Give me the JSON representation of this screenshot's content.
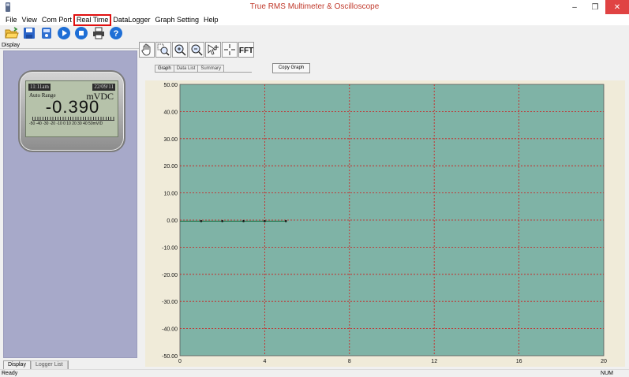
{
  "window": {
    "title": "True RMS Multimeter & Oscilloscope",
    "app_icon": "app-icon",
    "controls": {
      "minimize": "–",
      "maximize": "❐",
      "close": "✕"
    }
  },
  "menu": [
    {
      "label": "File"
    },
    {
      "label": "View"
    },
    {
      "label": "Com Port"
    },
    {
      "label": "Real Time",
      "highlighted": true
    },
    {
      "label": "DataLogger"
    },
    {
      "label": "Graph Setting"
    },
    {
      "label": "Help"
    }
  ],
  "toolbar": {
    "icons": [
      "open-folder-icon",
      "save-icon",
      "meter-icon",
      "play-icon",
      "stop-icon",
      "print-icon",
      "help-icon"
    ]
  },
  "left_panel": {
    "header": "Display",
    "meter": {
      "time": "11:11am",
      "date": "22/09/11",
      "range_mode": "Auto Range",
      "unit": "mVDC",
      "value": "-0.390",
      "scale_text": "-50 -40 -30 -20 -10  0  10  20  30  40  50mV/D"
    },
    "tabs": [
      {
        "label": "Display",
        "active": true
      },
      {
        "label": "Logger List",
        "active": false
      }
    ]
  },
  "graph_toolbar": {
    "icons": [
      "hand-pan-icon",
      "zoom-window-icon",
      "zoom-in-icon",
      "zoom-out-icon",
      "cursor-icon",
      "crosshair-icon",
      "fft-icon"
    ],
    "fft_label": "FFT"
  },
  "graph_tabs": [
    {
      "label": "Graph",
      "active": true
    },
    {
      "label": "Data List",
      "active": false
    },
    {
      "label": "Summary",
      "active": false
    }
  ],
  "copy_graph_label": "Copy Graph",
  "colors": {
    "plot_bg": "#7fb3a6",
    "grid_line": "#d01818",
    "trace": "#0d6a3a",
    "panel_bg": "#a7a9c9"
  },
  "chart_data": {
    "type": "line",
    "title": "",
    "xlabel": "",
    "ylabel": "",
    "xlim": [
      0,
      20
    ],
    "ylim": [
      -50,
      50
    ],
    "x_ticks": [
      0,
      4,
      8,
      12,
      16,
      20
    ],
    "y_ticks": [
      50,
      40,
      30,
      20,
      10,
      0,
      -10,
      -20,
      -30,
      -40,
      -50
    ],
    "x_tick_labels": [
      "0",
      "4",
      "8",
      "12",
      "16",
      "20"
    ],
    "y_tick_labels": [
      "50.00",
      "40.00",
      "30.00",
      "20.00",
      "10.00",
      "0.00",
      "-10.00",
      "-20.00",
      "-30.00",
      "-40.00",
      "-50.00"
    ],
    "grid": true,
    "series": [
      {
        "x": [
          0,
          1,
          2,
          3,
          4,
          5
        ],
        "y": [
          -0.39,
          -0.39,
          -0.39,
          -0.39,
          -0.39,
          -0.39
        ]
      }
    ]
  },
  "statusbar": {
    "left": "Ready",
    "right": "NUM"
  }
}
